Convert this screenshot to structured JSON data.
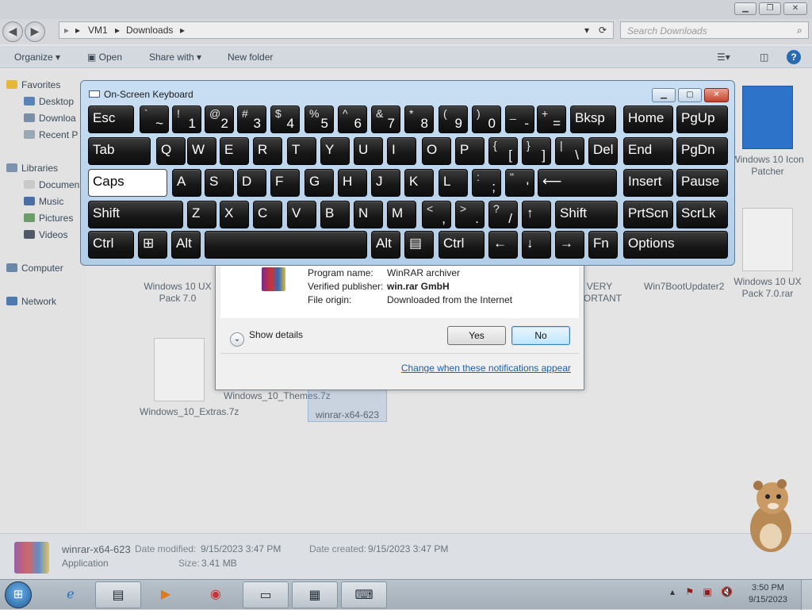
{
  "explorer": {
    "address": {
      "segments": [
        "VM1",
        "Downloads"
      ]
    },
    "search_placeholder": "Search Downloads",
    "toolbar": {
      "organize": "Organize ▾",
      "open": "Open",
      "share_with": "Share with ▾",
      "new_folder": "New folder"
    },
    "nav": {
      "favorites": "Favorites",
      "desktop": "Desktop",
      "downloads": "Downloa",
      "recent": "Recent P",
      "libraries": "Libraries",
      "documents": "Documen",
      "music": "Music",
      "pictures": "Pictures",
      "videos": "Videos",
      "computer": "Computer",
      "network": "Network"
    },
    "files": [
      {
        "name": "Windows 10 UX Pack 7.0"
      },
      {
        "name": "VERY PORTANT"
      },
      {
        "name": "Win7BootUpdater2"
      },
      {
        "name": "Windows 10 UX Pack 7.0.rar"
      },
      {
        "name": "Windows 10 Icon Patcher"
      },
      {
        "name": "Windows_10_Extras.7z"
      },
      {
        "name": "Windows_10_Themes.7z"
      },
      {
        "name": "winrar-x64-623"
      }
    ],
    "details": {
      "filename": "winrar-x64-623",
      "type": "Application",
      "date_modified_label": "Date modified:",
      "date_modified": "9/15/2023 3:47 PM",
      "size_label": "Size:",
      "size": "3.41 MB",
      "date_created_label": "Date created:",
      "date_created": "9/15/2023 3:47 PM"
    }
  },
  "uac": {
    "program_name_label": "Program name:",
    "program_name": "WinRAR archiver",
    "publisher_label": "Verified publisher:",
    "publisher": "win.rar GmbH",
    "origin_label": "File origin:",
    "origin": "Downloaded from the Internet",
    "show_details": "Show details",
    "yes": "Yes",
    "no": "No",
    "change_link": "Change when these notifications appear"
  },
  "osk": {
    "title": "On-Screen Keyboard",
    "keys": {
      "esc": "Esc",
      "tilde": "~",
      "grave": "`",
      "k1s": "!",
      "k1": "1",
      "k2s": "@",
      "k2": "2",
      "k3s": "#",
      "k3": "3",
      "k4s": "$",
      "k4": "4",
      "k5s": "%",
      "k5": "5",
      "k6s": "^",
      "k6": "6",
      "k7s": "&",
      "k7": "7",
      "k8s": "*",
      "k8": "8",
      "k9s": "(",
      "k9": "9",
      "k0s": ")",
      "k0": "0",
      "minuss": "_",
      "minus": "-",
      "pluss": "+",
      "plus": "=",
      "bksp": "Bksp",
      "home": "Home",
      "pgup": "PgUp",
      "tab": "Tab",
      "q": "Q",
      "w": "W",
      "e": "E",
      "r": "R",
      "t": "T",
      "y": "Y",
      "u": "U",
      "i": "I",
      "o": "O",
      "p": "P",
      "lbrs": "{",
      "lbr": "[",
      "rbrs": "}",
      "rbr": "]",
      "pipes": "|",
      "pipe": "\\",
      "del": "Del",
      "end": "End",
      "pgdn": "PgDn",
      "caps": "Caps",
      "a": "A",
      "s": "S",
      "d": "D",
      "f": "F",
      "g": "G",
      "h": "H",
      "j": "J",
      "k": "K",
      "l": "L",
      "semis": ":",
      "semi": ";",
      "quotes": "\"",
      "quote": "'",
      "enter": "⟵",
      "insert": "Insert",
      "pause": "Pause",
      "lshift": "Shift",
      "z": "Z",
      "x": "X",
      "c": "C",
      "v": "V",
      "b": "B",
      "n": "N",
      "m": "M",
      "commas": "<",
      "comma": ",",
      "dots": ">",
      "dot": ".",
      "slashs": "?",
      "slash": "/",
      "up": "↑",
      "rshift": "Shift",
      "prtscn": "PrtScn",
      "scrlk": "ScrLk",
      "lctrl": "Ctrl",
      "win": "⊞",
      "lalt": "Alt",
      "space": "",
      "ralt": "Alt",
      "menu": "▤",
      "rctrl": "Ctrl",
      "left": "←",
      "down": "↓",
      "right": "→",
      "fn": "Fn",
      "options": "Options"
    }
  },
  "taskbar": {
    "start_icon": "windows-orb",
    "clock_time": "3:50 PM",
    "clock_date": "9/15/2023"
  }
}
